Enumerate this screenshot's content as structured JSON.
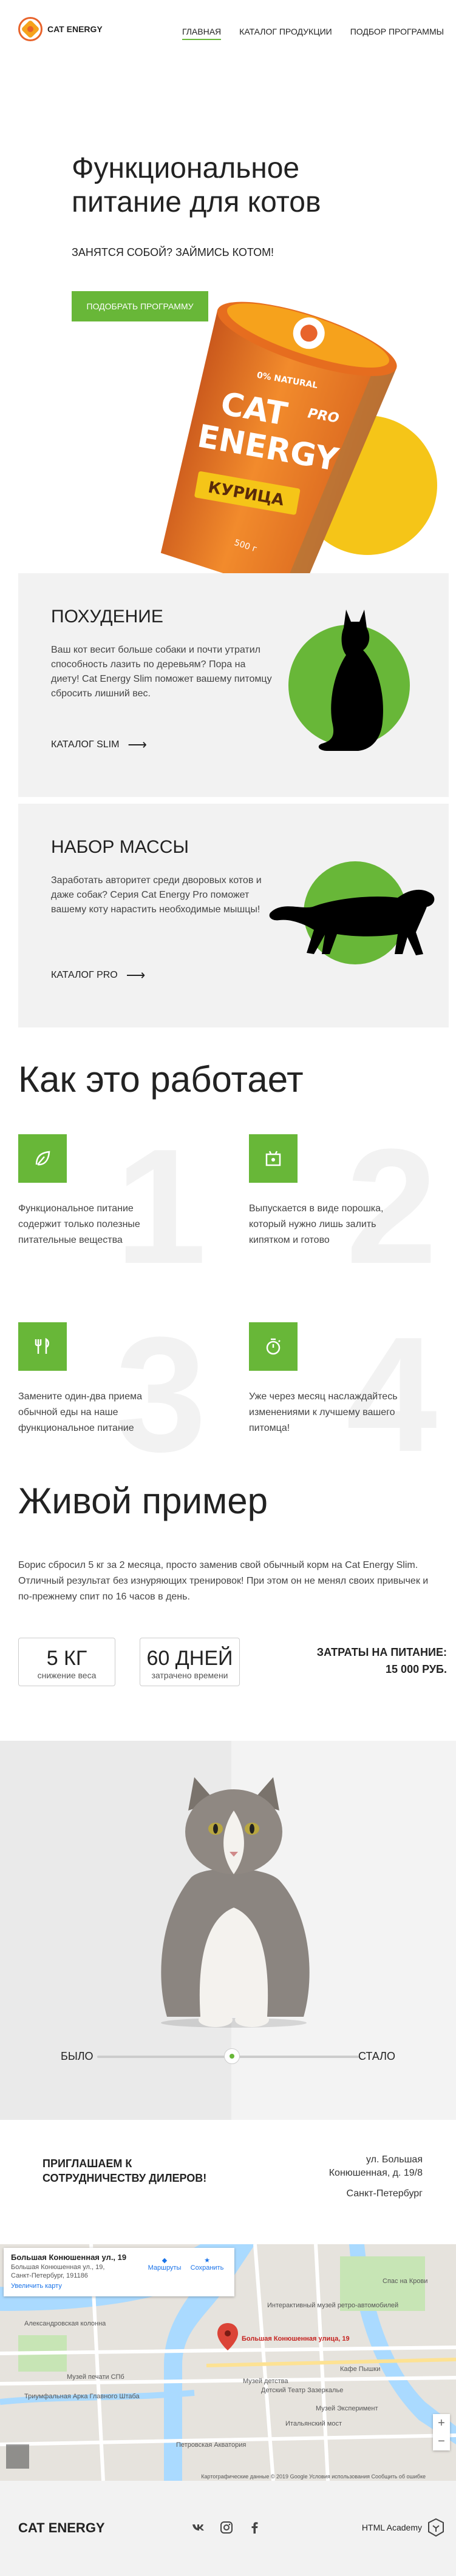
{
  "header": {
    "logo_text": "CAT ENERGY",
    "nav": [
      "ГЛАВНАЯ",
      "КАТАЛОГ ПРОДУКЦИИ",
      "ПОДБОР ПРОГРАММЫ"
    ]
  },
  "hero": {
    "title_line1": "Функциональное",
    "title_line2": "питание для котов",
    "subtitle": "ЗАНЯТСЯ СОБОЙ? ЗАЙМИСЬ КОТОМ!",
    "button": "ПОДОБРАТЬ ПРОГРАММУ",
    "product": {
      "brand1": "CAT",
      "brand2": "ENERGY",
      "line": "PRO",
      "flavor": "КУРИЦА",
      "natural": "0% NATURAL",
      "weight": "500 г"
    }
  },
  "programs": [
    {
      "title": "ПОХУДЕНИЕ",
      "text": "Ваш кот весит больше собаки и почти утратил способность лазить по деревьям? Пора на диету! Cat Energy Slim поможет вашему питомцу сбросить лишний вес.",
      "link": "КАТАЛОГ SLIM"
    },
    {
      "title": "НАБОР МАССЫ",
      "text": "Заработать авторитет среди дворовых котов и даже собак? Серия Cat Energy Pro поможет вашему коту нарастить необходимые мышцы!",
      "link": "КАТАЛОГ PRO"
    }
  ],
  "how": {
    "title": "Как это работает",
    "steps": [
      {
        "num": "1",
        "text": "Функциональное питание содержит только полезные питательные вещества",
        "icon": "leaf-icon"
      },
      {
        "num": "2",
        "text": "Выпускается в виде порошка, который нужно лишь залить кипятком и готово",
        "icon": "package-icon"
      },
      {
        "num": "3",
        "text": "Замените один-два приема обычной еды на наше функциональное питание",
        "icon": "fork-knife-icon"
      },
      {
        "num": "4",
        "text": "Уже через месяц наслаждайтесь изменениями к лучшему вашего питомца!",
        "icon": "timer-icon"
      }
    ]
  },
  "live": {
    "title": "Живой пример",
    "text": "Борис сбросил 5 кг за 2 месяца, просто заменив свой обычный корм на Cat Energy Slim. Отличный результат без изнуряющих тренировок! При этом он не менял своих привычек и по-прежнему спит по 16 часов в день.",
    "stats": [
      {
        "value": "5 КГ",
        "label": "снижение веса"
      },
      {
        "value": "60 ДНЕЙ",
        "label": "затрачено времени"
      }
    ],
    "costs_label": "ЗАТРАТЫ НА ПИТАНИЕ:",
    "costs_value": "15 000 РУБ.",
    "slider": {
      "before": "БЫЛО",
      "after": "СТАЛО",
      "position": 0.5
    }
  },
  "contacts": {
    "partner": "ПРИГЛАШАЕМ К СОТРУДНИЧЕСТВУ ДИЛЕРОВ!",
    "address_line1": "ул. Большая",
    "address_line2": "Конюшенная, д. 19/8",
    "address_line3": "Санкт-Петербург"
  },
  "map": {
    "place_title": "Большая Конюшенная ул., 19",
    "place_address": "Большая Конюшенная ул., 19, Санкт-Петербург, 191186",
    "enlarge": "Увеличить карту",
    "route": "Маршруты",
    "save": "Сохранить",
    "pin_label": "Большая Конюшенная улица, 19",
    "labels": [
      "Спас на Крови",
      "Александровская колонна",
      "Музей печати СПб",
      "Триумфальная Арка Главного Штаба",
      "Детский Театр Зазеркалье",
      "Музей Эксперимент",
      "Итальянский мост",
      "Петровская Акватория",
      "Интерактивный музей ретро-автомобилей",
      "Кафе Пышки",
      "Музей детства"
    ],
    "credits": "Картографические данные © 2019 Google  Условия использования  Сообщить об ошибке"
  },
  "footer": {
    "logo": "CAT ENERGY",
    "social": [
      "vk-icon",
      "instagram-icon",
      "facebook-icon"
    ],
    "academy": "HTML Academy"
  }
}
